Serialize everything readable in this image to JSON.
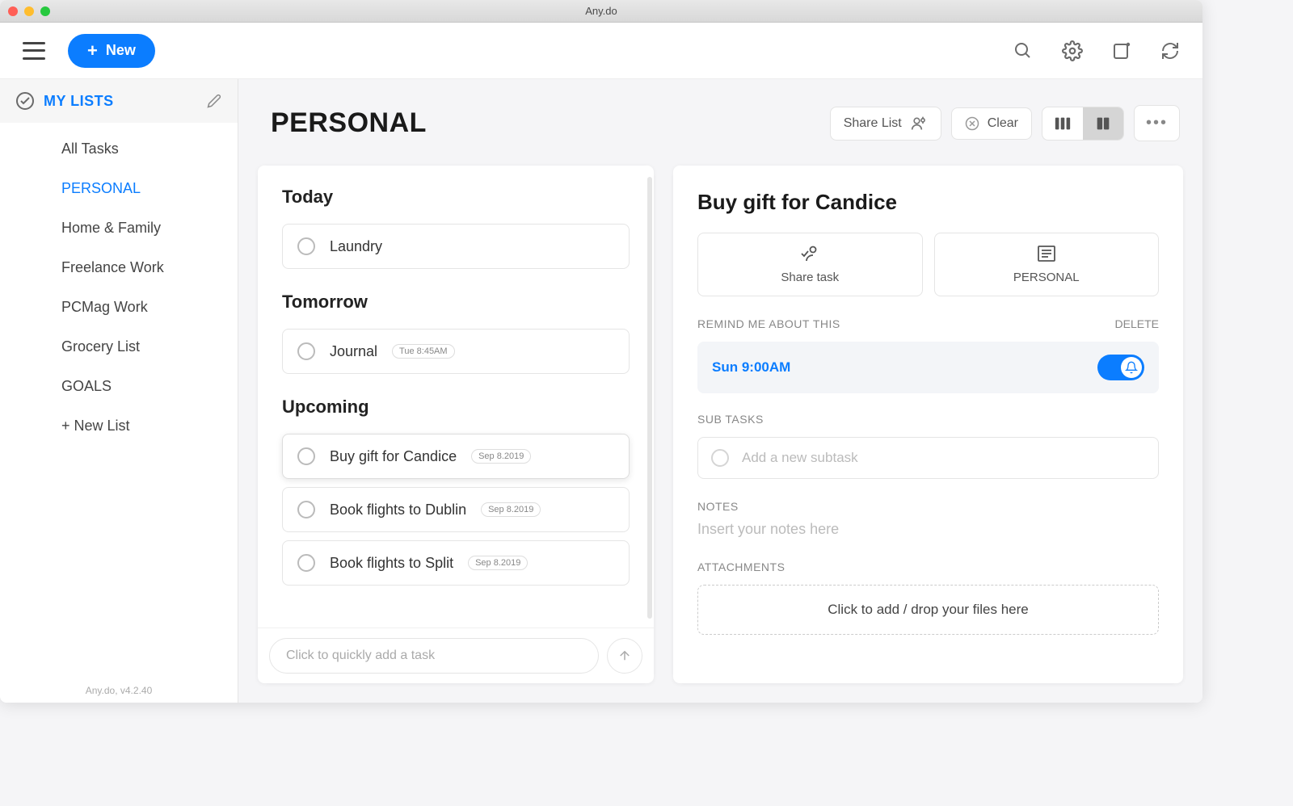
{
  "window": {
    "title": "Any.do"
  },
  "toolbar": {
    "new_label": "New"
  },
  "sidebar": {
    "header": "MY LISTS",
    "items": [
      {
        "label": "All Tasks"
      },
      {
        "label": "PERSONAL"
      },
      {
        "label": "Home & Family"
      },
      {
        "label": "Freelance Work"
      },
      {
        "label": "PCMag Work"
      },
      {
        "label": "Grocery List"
      },
      {
        "label": "GOALS"
      }
    ],
    "new_list": "+ New List",
    "footer": "Any.do, v4.2.40"
  },
  "main": {
    "title": "PERSONAL",
    "share_label": "Share List",
    "clear_label": "Clear",
    "sections": {
      "today": {
        "title": "Today",
        "tasks": [
          {
            "name": "Laundry",
            "date": ""
          }
        ]
      },
      "tomorrow": {
        "title": "Tomorrow",
        "tasks": [
          {
            "name": "Journal",
            "date": "Tue 8:45AM"
          }
        ]
      },
      "upcoming": {
        "title": "Upcoming",
        "tasks": [
          {
            "name": "Buy gift for Candice",
            "date": "Sep 8.2019"
          },
          {
            "name": "Book flights to Dublin",
            "date": "Sep 8.2019"
          },
          {
            "name": "Book flights to Split",
            "date": "Sep 8.2019"
          }
        ]
      }
    },
    "quick_add_placeholder": "Click to quickly add a task"
  },
  "detail": {
    "title": "Buy gift for Candice",
    "share_card": "Share task",
    "list_card": "PERSONAL",
    "remind_label": "REMIND ME ABOUT THIS",
    "delete_label": "DELETE",
    "reminder_time": "Sun 9:00AM",
    "subtasks_label": "SUB TASKS",
    "subtask_placeholder": "Add a new subtask",
    "notes_label": "NOTES",
    "notes_placeholder": "Insert your notes here",
    "attachments_label": "ATTACHMENTS",
    "attachments_text": "Click to add / drop your files here"
  }
}
